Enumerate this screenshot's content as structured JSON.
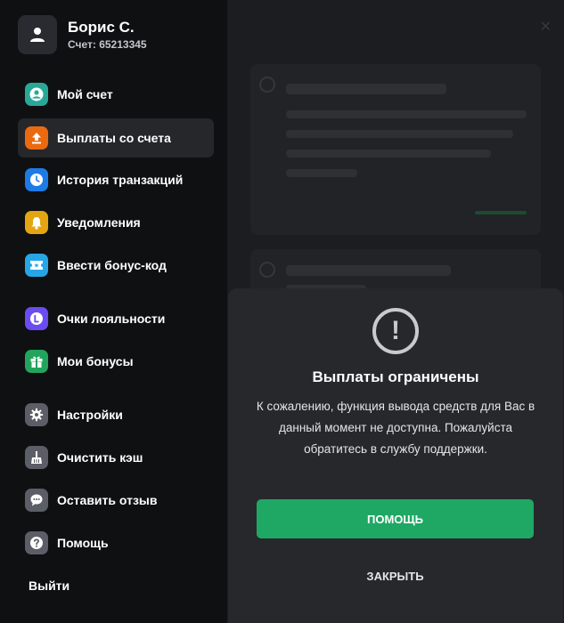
{
  "user": {
    "name": "Борис С.",
    "account_label": "Счет: 65213345"
  },
  "sidebar": {
    "items": [
      {
        "label": "Мой счет",
        "icon": "user-circle-icon",
        "color": "#2aa897"
      },
      {
        "label": "Выплаты со счета",
        "icon": "upload-arrow-icon",
        "color": "#ea6a10",
        "active": true
      },
      {
        "label": "История транзакций",
        "icon": "clock-icon",
        "color": "#1e7be6"
      },
      {
        "label": "Уведомления",
        "icon": "bell-icon",
        "color": "#e3a512"
      },
      {
        "label": "Ввести бонус-код",
        "icon": "ticket-icon",
        "color": "#27a6e6"
      },
      {
        "label": "Очки лояльности",
        "icon": "loyalty-coin-icon",
        "color": "#6a4cf0"
      },
      {
        "label": "Мои бонусы",
        "icon": "gift-icon",
        "color": "#22a45d"
      },
      {
        "label": "Настройки",
        "icon": "gear-icon",
        "color": "#5b5e66"
      },
      {
        "label": "Очистить кэш",
        "icon": "broom-icon",
        "color": "#5b5e66"
      },
      {
        "label": "Оставить отзыв",
        "icon": "chat-bubble-icon",
        "color": "#5b5e66"
      },
      {
        "label": "Помощь",
        "icon": "question-icon",
        "color": "#5b5e66"
      }
    ],
    "logout_label": "Выйти"
  },
  "modal": {
    "icon": "exclamation-circle-icon",
    "title": "Выплаты ограничены",
    "message": "К сожалению, функция вывода средств для Вас в данный момент не доступна. Пожалуйста обратитесь в службу поддержки.",
    "help_button": "ПОМОЩЬ",
    "close_button": "ЗАКРЫТЬ"
  },
  "colors": {
    "accent_green": "#1fa864",
    "sidebar_bg": "#0f1012",
    "modal_bg": "#26282c"
  }
}
